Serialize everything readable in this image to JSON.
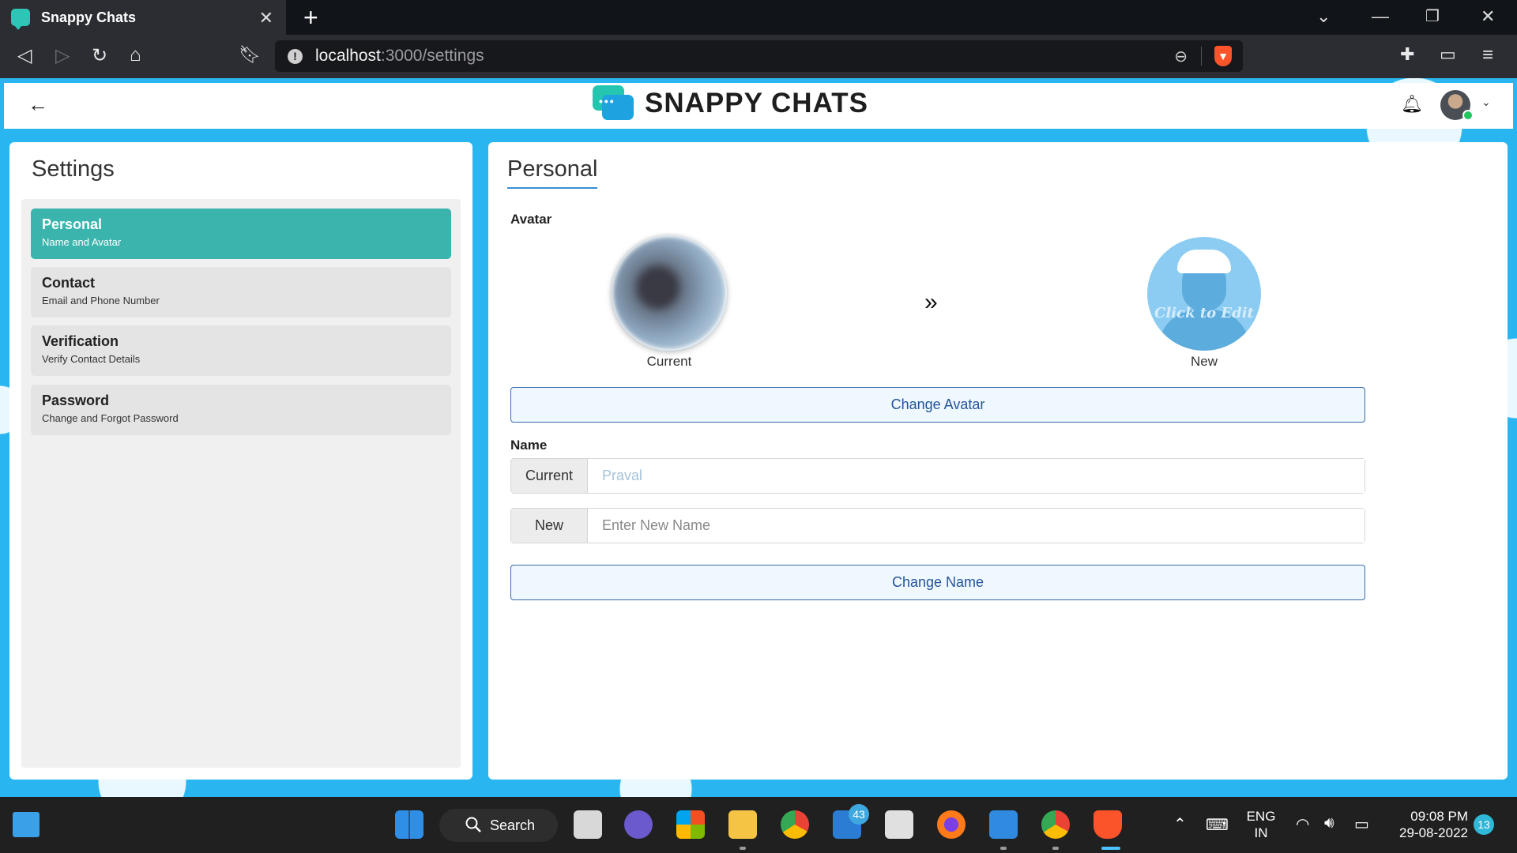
{
  "browser": {
    "tab_title": "Snappy Chats",
    "tab_close": "✕",
    "new_tab": "+",
    "url_host": "localhost",
    "url_path": ":3000/settings"
  },
  "app": {
    "logo_text": "SNAPPY CHATS",
    "back_icon": "←"
  },
  "settings": {
    "title": "Settings",
    "items": [
      {
        "title": "Personal",
        "subtitle": "Name and Avatar",
        "active": true
      },
      {
        "title": "Contact",
        "subtitle": "Email and Phone Number",
        "active": false
      },
      {
        "title": "Verification",
        "subtitle": "Verify Contact Details",
        "active": false
      },
      {
        "title": "Password",
        "subtitle": "Change and Forgot Password",
        "active": false
      }
    ]
  },
  "personal": {
    "title": "Personal",
    "avatar_label": "Avatar",
    "current_caption": "Current",
    "new_caption": "New",
    "new_avatar_overlay": "Click to Edit",
    "change_avatar_button": "Change Avatar",
    "name_label": "Name",
    "current_addon": "Current",
    "current_name_value": "Praval",
    "new_addon": "New",
    "new_name_placeholder": "Enter New Name",
    "change_name_button": "Change Name"
  },
  "taskbar": {
    "search_label": "Search",
    "mail_badge": "43",
    "language_line1": "ENG",
    "language_line2": "IN",
    "time": "09:08 PM",
    "date": "29-08-2022",
    "notification_count": "13"
  },
  "colors": {
    "accent": "#3bb4ad",
    "page_background": "#29b6f0",
    "button_text": "#25539a"
  }
}
